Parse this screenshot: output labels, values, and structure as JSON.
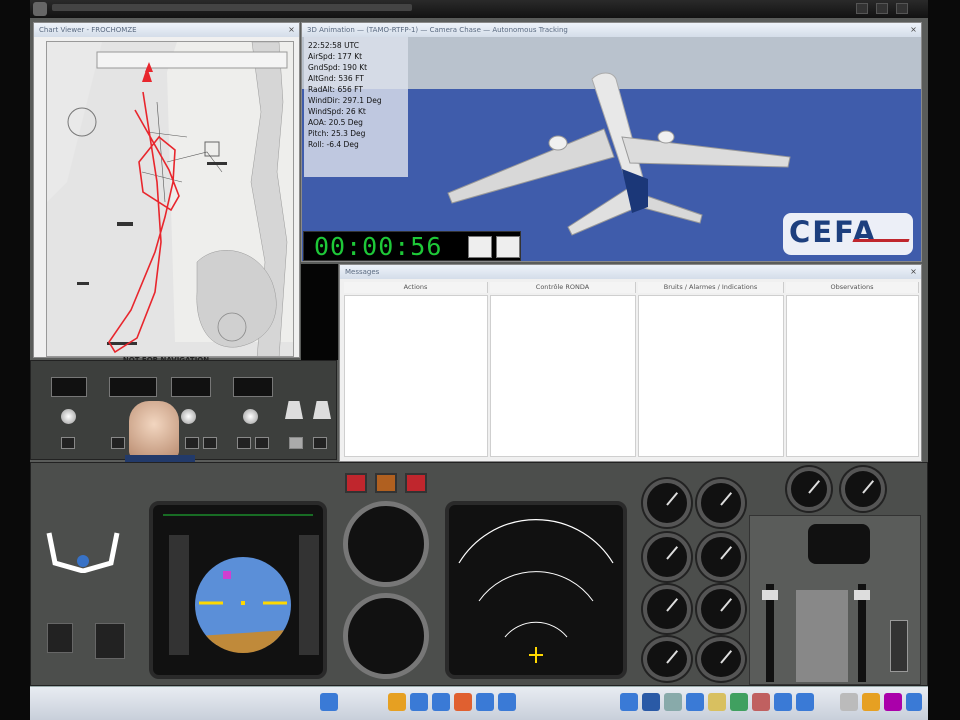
{
  "chart_window": {
    "title": "Chart Viewer - FROCHOMZE",
    "footer": "NOT FOR NAVIGATION"
  },
  "sim_window": {
    "title": "3D Animation — (TAMO-RTFP-1) — Camera Chase — Autonomous Tracking"
  },
  "hud": [
    "22:52:58 UTC",
    "AirSpd: 177 Kt",
    "GndSpd: 190 Kt",
    "AltGnd: 536 FT",
    "RadAlt: 656 FT",
    "WindDir: 297.1 Deg",
    "WindSpd: 26 Kt",
    "AOA: 20.5 Deg",
    "Pitch: 25.3 Deg",
    "Roll: -6.4 Deg"
  ],
  "timer": "00:00:56",
  "brand": "CEFA",
  "messages_window": {
    "title": "Messages",
    "columns": [
      "Actions",
      "Contrôle RONDA",
      "Bruits / Alarmes / Indications",
      "Observations"
    ]
  },
  "colors": {
    "accent": "#1d3f7e",
    "route": "#e8262d",
    "timer": "#1ec838",
    "sky": "#5b8fd8",
    "ground": "#c08a3a"
  }
}
